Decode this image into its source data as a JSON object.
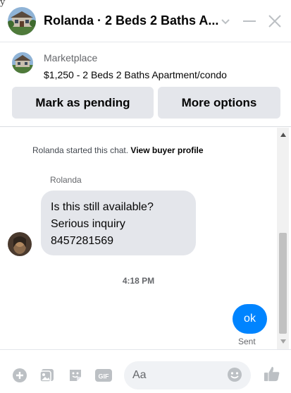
{
  "header": {
    "title": "Rolanda · 2 Beds 2 Baths A..."
  },
  "listing": {
    "source": "Marketplace",
    "title": "$1,250 - 2 Beds 2 Baths Apartment/condo",
    "buttons": {
      "mark_pending": "Mark as pending",
      "more_options": "More options"
    }
  },
  "chat": {
    "started_text": "Rolanda started this chat.",
    "view_profile": "View buyer profile",
    "sender_name": "Rolanda",
    "incoming_lines": [
      "Is this still available?",
      "Serious inquiry",
      "8457281569"
    ],
    "timestamp": "4:18 PM",
    "outgoing_text": "ok",
    "sent_status": "Sent"
  },
  "composer": {
    "placeholder": "Aa"
  },
  "icons": {
    "header": [
      "house-photo-avatar",
      "chevron-down-icon",
      "minimize-icon",
      "close-icon"
    ],
    "composer": [
      "plus-icon",
      "gallery-icon",
      "sticker-icon",
      "gif-icon",
      "emoji-icon",
      "thumbs-up-icon"
    ]
  },
  "colors": {
    "accent": "#0084ff",
    "bubble_in": "#e4e6eb",
    "button_bg": "#e4e6eb",
    "muted_text": "#65676b"
  }
}
